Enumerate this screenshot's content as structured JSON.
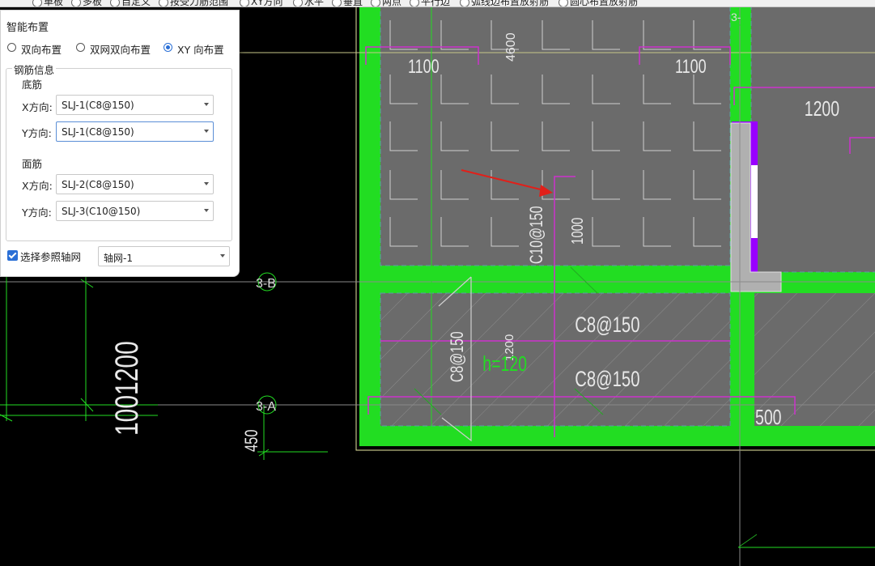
{
  "toolbar": {
    "items": [
      "单板",
      "多板",
      "自定义",
      "按受力筋范围",
      "XY方向",
      "水平",
      "垂直",
      "两点",
      "平行边",
      "弧线边布置放射筋",
      "圆心布置放射筋"
    ]
  },
  "panel": {
    "title": "智能布置",
    "layout_options": [
      "双向布置",
      "双网双向布置",
      "XY 向布置"
    ],
    "selected_layout": "XY 向布置",
    "rebar_group_label": "钢筋信息",
    "bottom_label": "底筋",
    "top_label": "面筋",
    "x_dir_label": "X方向:",
    "y_dir_label": "Y方向:",
    "bottom_x": "SLJ-1(C8@150)",
    "bottom_y": "SLJ-1(C8@150)",
    "top_x": "SLJ-2(C8@150)",
    "top_y": "SLJ-3(C10@150)",
    "axis_check_label": "选择参照轴网",
    "axis_checked": true,
    "axis_value": "轴网-1"
  },
  "drawing": {
    "axis_labels": [
      "3-B",
      "3-A",
      "3-"
    ],
    "dim_texts": {
      "d1100_left": "1100",
      "d1100_right": "1100",
      "d4600": "4600",
      "d1200_top": "1200",
      "d1000": "1000",
      "rebar_c10": "C10@150",
      "rebar_c8_a": "C8@150",
      "rebar_c8_b": "C8@150",
      "rebar_c8_v": "C8@150",
      "d1200_mid": "1200",
      "h120": "h=120",
      "d500": "500",
      "d450": "450",
      "d1001200": "1001200"
    },
    "colors": {
      "background": "#000000",
      "slab_fill": "#6b6b6b",
      "beam_green": "#22dd22",
      "rebar_magenta": "#cc33cc",
      "axis_line": "#8a8a8a",
      "arrow_red": "#e0201a",
      "wall_purple": "#9900ff"
    }
  }
}
